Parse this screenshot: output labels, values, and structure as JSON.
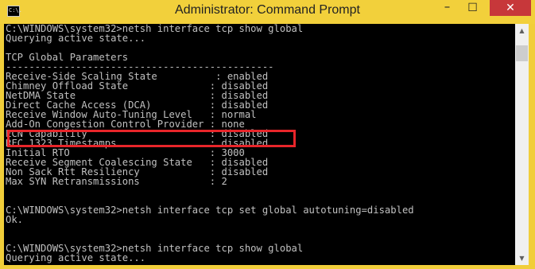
{
  "window": {
    "title": "Administrator: Command Prompt",
    "icon_text": "C:\\.",
    "minimize_glyph": "–",
    "maximize_glyph": "☐",
    "close_glyph": "✕",
    "accent_color": "#f2d03b",
    "close_color": "#c7373a",
    "highlight_color": "#e8252a"
  },
  "console": {
    "lines": [
      "C:\\WINDOWS\\system32>netsh interface tcp show global",
      "Querying active state...",
      "",
      "TCP Global Parameters",
      "----------------------------------------------",
      "Receive-Side Scaling State          : enabled",
      "Chimney Offload State              : disabled",
      "NetDMA State                       : disabled",
      "Direct Cache Access (DCA)          : disabled",
      "Receive Window Auto-Tuning Level   : normal",
      "Add-On Congestion Control Provider : none",
      "ECN Capability                     : disabled",
      "RFC 1323 Timestamps                : disabled",
      "Initial RTO                        : 3000",
      "Receive Segment Coalescing State   : disabled",
      "Non Sack Rtt Resiliency            : disabled",
      "Max SYN Retransmissions            : 2",
      "",
      "",
      "C:\\WINDOWS\\system32>netsh interface tcp set global autotuning=disabled",
      "Ok.",
      "",
      "",
      "C:\\WINDOWS\\system32>netsh interface tcp show global",
      "Querying active state..."
    ]
  },
  "scrollbar": {
    "up_glyph": "▲",
    "down_glyph": "▼"
  }
}
